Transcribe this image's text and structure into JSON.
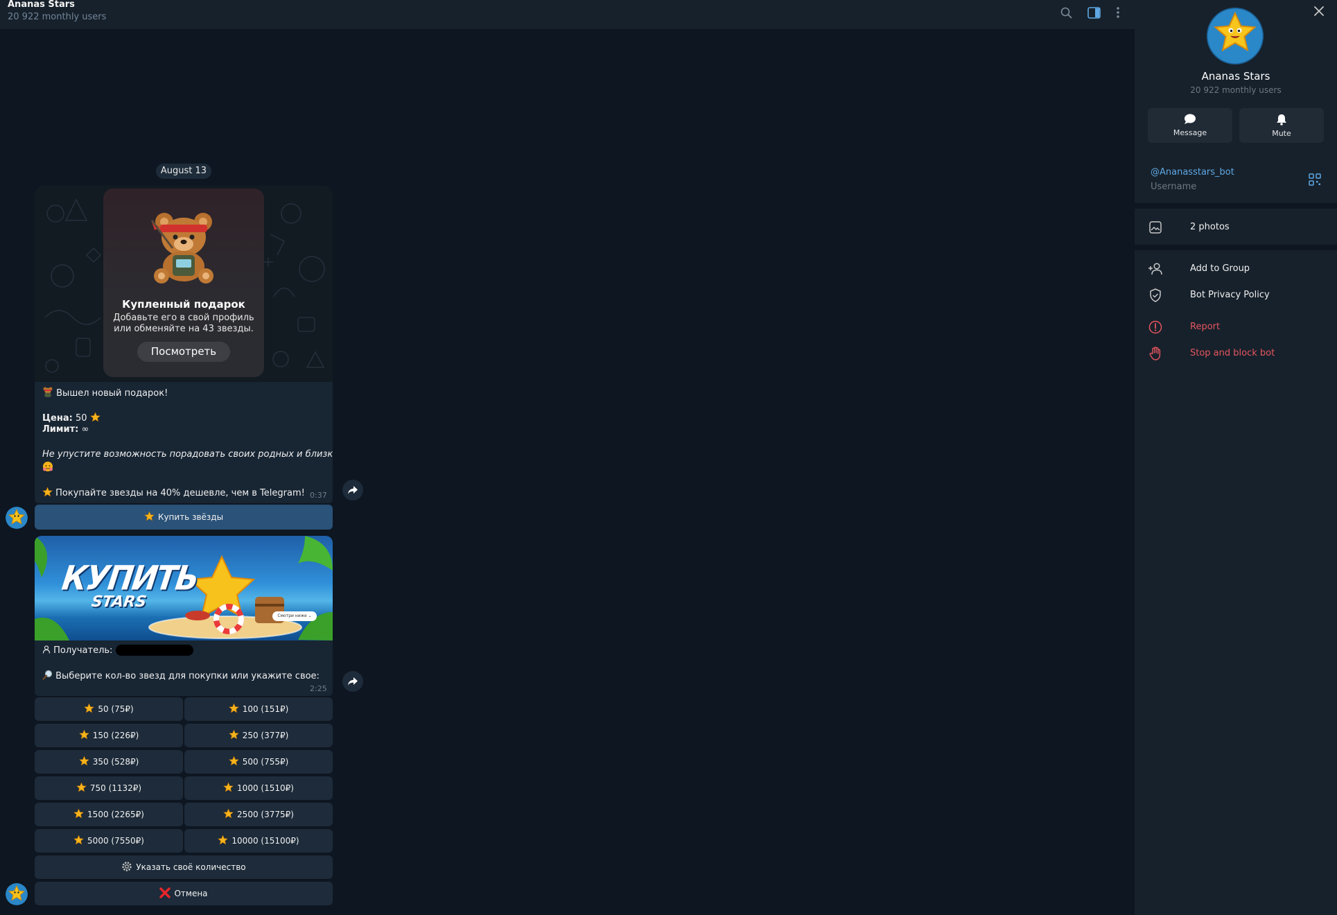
{
  "colors": {
    "chat_bg": "#0e1621",
    "header_bg": "#17212b",
    "bubble_bg": "#182533",
    "keyboard_btn_bg": "#1d2b3a",
    "accent_btn_bg": "#2b5278",
    "link": "#5fa8e4",
    "danger": "#e5555f",
    "muted": "#708499"
  },
  "header": {
    "title": "Ananas Stars",
    "subtitle": "20 922 monthly users",
    "icons": [
      "search-icon",
      "sidebar-toggle-icon",
      "more-vertical-icon"
    ]
  },
  "chat": {
    "date_chip": "August 13",
    "message1": {
      "gift_card": {
        "title": "Купленный подарок",
        "desc_line1": "Добавьте его в свой профиль",
        "desc_line2": "или обменяйте на 43 звезды.",
        "button": "Посмотреть"
      },
      "headline": "Вышел новый подарок!",
      "price_label": "Цена:",
      "price_value": "50",
      "limit_label": "Лимит:",
      "limit_value": "∞",
      "italic_text": "Не упустите возможность порадовать своих родных и близких",
      "promo": "Покупайте звезды на 40% дешевле, чем в Telegram!",
      "time": "0:37",
      "button": "Купить звёзды"
    },
    "message2": {
      "banner_title": "КУПИТЬ",
      "banner_sub": "STARS",
      "banner_pill": "Смотри ниже ⌄",
      "recipient_label": "Получатель:",
      "prompt": "Выберите кол-во звезд для покупки или укажите свое:",
      "time": "2:25",
      "keyboard": [
        [
          "50 (75₽)",
          "100 (151₽)"
        ],
        [
          "150 (226₽)",
          "250 (377₽)"
        ],
        [
          "350 (528₽)",
          "500 (755₽)"
        ],
        [
          "750 (1132₽)",
          "1000 (1510₽)"
        ],
        [
          "1500 (2265₽)",
          "2500 (3775₽)"
        ],
        [
          "5000 (7550₽)",
          "10000 (15100₽)"
        ]
      ],
      "custom_button": "Указать своё количество",
      "cancel_button": "Отмена"
    }
  },
  "panel": {
    "name": "Ananas Stars",
    "subtitle": "20 922 monthly users",
    "message_btn": "Message",
    "mute_btn": "Mute",
    "username": "@Ananasstars_bot",
    "username_label": "Username",
    "photos": "2 photos",
    "add_to_group": "Add to Group",
    "privacy": "Bot Privacy Policy",
    "report": "Report",
    "block": "Stop and block bot"
  }
}
